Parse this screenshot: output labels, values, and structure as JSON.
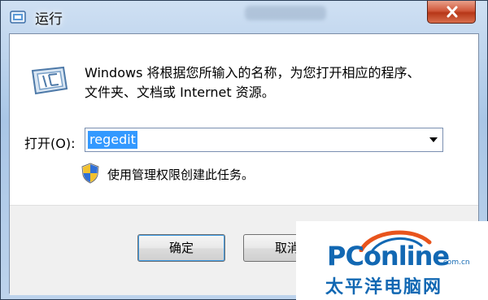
{
  "window": {
    "title": "运行",
    "close_icon": "close-icon"
  },
  "dialog": {
    "description_line1": "Windows 将根据您所输入的名称，为您打开相应的程序、",
    "description_line2": "文件夹、文档或 Internet 资源。",
    "open_label": "打开(O):",
    "open_value": "regedit",
    "admin_note": "使用管理权限创建此任务。"
  },
  "buttons": {
    "ok": "确定",
    "cancel": "取消"
  },
  "watermark": {
    "brand_main": "PConline",
    "brand_suffix": ".com.cn",
    "brand_cn": "太平洋电脑网"
  },
  "colors": {
    "selection": "#3399ff",
    "brand_blue": "#1268b3",
    "brand_orange": "#e8541d"
  }
}
